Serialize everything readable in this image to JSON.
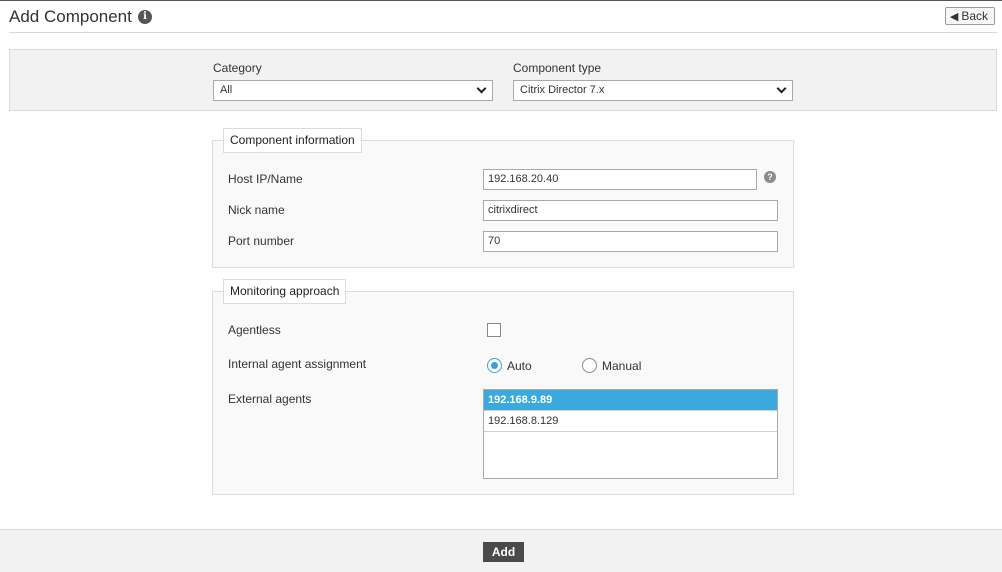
{
  "page": {
    "title": "Add Component",
    "back_label": "Back"
  },
  "filters": {
    "category_label": "Category",
    "category_value": "All",
    "component_type_label": "Component type",
    "component_type_value": "Citrix Director 7.x"
  },
  "component_info": {
    "legend": "Component information",
    "host_label": "Host IP/Name",
    "host_value": "192.168.20.40",
    "nick_label": "Nick name",
    "nick_value": "citrixdirect",
    "port_label": "Port number",
    "port_value": "70"
  },
  "monitoring": {
    "legend": "Monitoring approach",
    "agentless_label": "Agentless",
    "agentless_checked": false,
    "internal_label": "Internal agent assignment",
    "auto_label": "Auto",
    "manual_label": "Manual",
    "selected_assignment": "Auto",
    "external_label": "External agents",
    "external_agents": [
      "192.168.9.89",
      "192.168.8.129"
    ],
    "selected_agent": "192.168.9.89"
  },
  "footer": {
    "add_label": "Add"
  },
  "colors": {
    "accent": "#3aa9dc",
    "button_dark": "#4a4a4a"
  }
}
